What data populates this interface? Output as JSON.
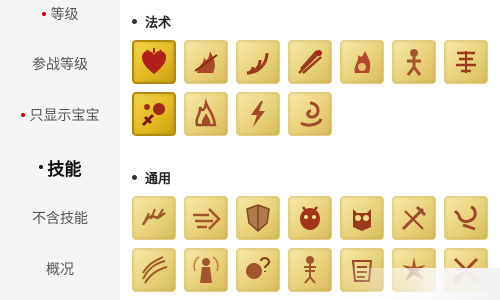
{
  "sidebar": {
    "items": [
      {
        "label": "等级",
        "dot": true,
        "active": false
      },
      {
        "label": "参战等级",
        "dot": false,
        "active": false
      },
      {
        "label": "只显示宝宝",
        "dot": true,
        "active": false
      },
      {
        "label": "技能",
        "dot": true,
        "active": true
      },
      {
        "label": "不含技能",
        "dot": false,
        "active": false
      },
      {
        "label": "概况",
        "dot": false,
        "active": false
      }
    ]
  },
  "sections": [
    {
      "title": "法术"
    },
    {
      "title": "通用"
    }
  ],
  "icons": {
    "magic": [
      "heart-icon",
      "fire-wave-icon",
      "sonic-wave-icon",
      "flame-dart-icon",
      "fire-skill-icon",
      "figure-skill-icon",
      "scroll-skill-icon",
      "strike-skill-icon",
      "spirit-flame-icon",
      "lightning-icon",
      "vortex-icon"
    ],
    "general": [
      "claw-icon",
      "rush-icon",
      "shield-icon",
      "demon-mask-icon",
      "owl-icon",
      "sword-icon",
      "hook-icon",
      "wind-icon",
      "figure-glow-icon",
      "question-mind-icon",
      "skeleton-icon",
      "scroll-icon",
      "burst-icon",
      "scissors-icon"
    ]
  },
  "selected_icons": [
    "heart-icon",
    "strike-skill-icon"
  ],
  "colors": {
    "accent_dot": "#cc0000",
    "tile_gold": "#e9d27a",
    "tile_selected": "#e3b820",
    "glyph": "#9a3a1a"
  }
}
